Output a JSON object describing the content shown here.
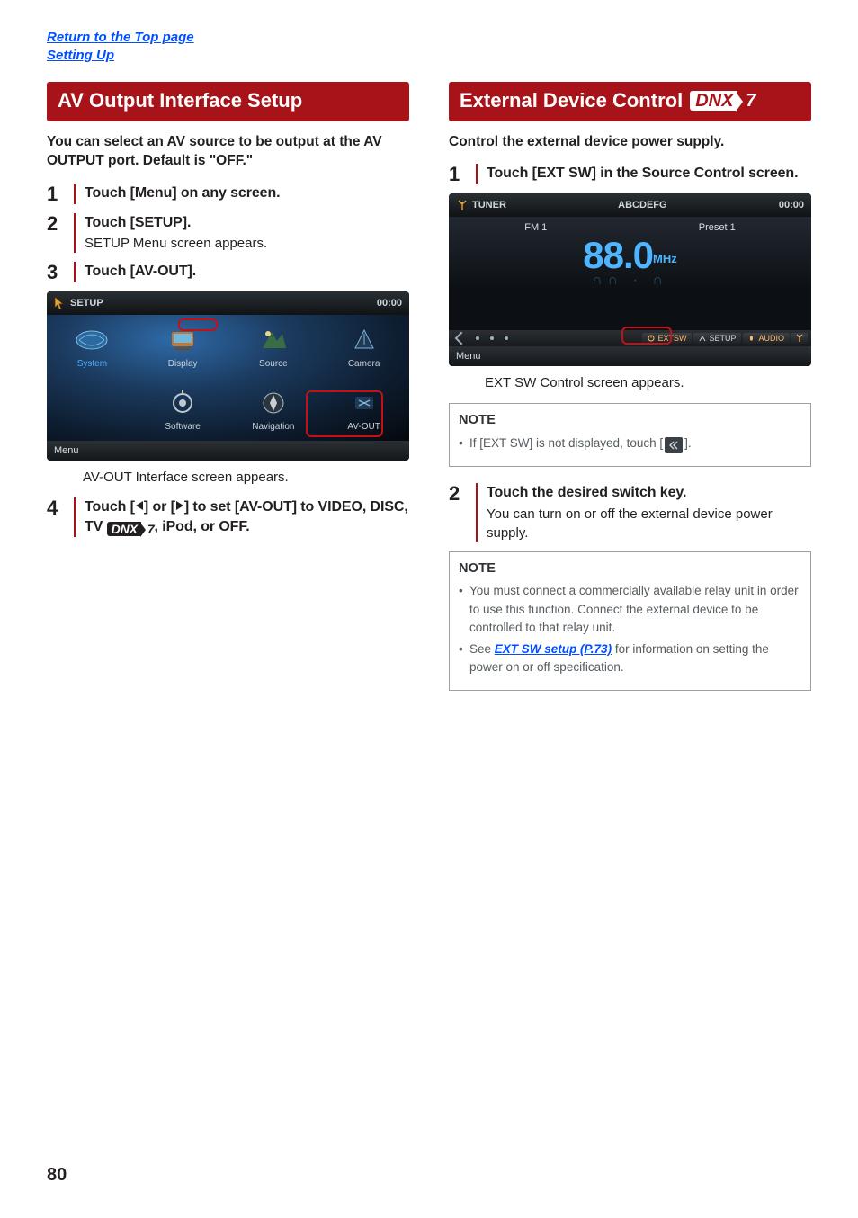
{
  "header": {
    "link_top": "Return to the Top page",
    "link_section": "Setting Up"
  },
  "left": {
    "title": "AV Output Interface Setup",
    "lead": "You can select an AV source to be output at the AV OUTPUT port. Default is \"OFF.\"",
    "steps": {
      "s1": {
        "title": "Touch [Menu] on any screen."
      },
      "s2": {
        "title": "Touch [SETUP].",
        "sub": "SETUP Menu screen appears."
      },
      "s3": {
        "title": "Touch [AV-OUT]."
      },
      "s4": {
        "title_a": "Touch [",
        "title_b": "] or [",
        "title_c": "] to set [AV-OUT] to VIDEO, DISC, TV ",
        "title_d": ", iPod, or OFF."
      }
    },
    "screenshot": {
      "title": "SETUP",
      "clock": "00:00",
      "cells": {
        "system": "System",
        "display": "Display",
        "source": "Source",
        "camera": "Camera",
        "software": "Software",
        "navigation": "Navigation",
        "avout": "AV-OUT"
      },
      "menu": "Menu"
    },
    "result": "AV-OUT Interface screen appears."
  },
  "right": {
    "title": "External Device Control",
    "dnx_box": "DNX",
    "dnx_tail": "7",
    "lead": "Control the external device power supply.",
    "steps": {
      "s1": {
        "title": "Touch [EXT SW] in the Source Control screen."
      },
      "s2": {
        "title": "Touch the desired switch key.",
        "sub": "You can turn on or off the external device power supply."
      }
    },
    "screenshot": {
      "title": "TUNER",
      "center_top": "ABCDEFG",
      "clock": "00:00",
      "band": "FM 1",
      "preset": "Preset 1",
      "freq": "88.0",
      "unit": "MHz",
      "shadow": "∩∩ · ∩",
      "buttons": {
        "extsw": "EXTSW",
        "setup": "SETUP",
        "audio": "AUDIO"
      },
      "menu": "Menu"
    },
    "result1": "EXT SW Control screen appears.",
    "note1": {
      "title": "NOTE",
      "item1a": "If [EXT SW] is not displayed, touch [",
      "item1b": "]."
    },
    "note2": {
      "title": "NOTE",
      "item1": "You must connect a commercially available relay unit in order to use this function. Connect the external device to be controlled to that relay unit.",
      "item2a": "See ",
      "item2link": "EXT SW setup (P.73)",
      "item2b": " for information on setting the power on or off specification."
    }
  },
  "page_number": "80",
  "inline_dnx": {
    "box": "DNX",
    "tail": "7"
  }
}
